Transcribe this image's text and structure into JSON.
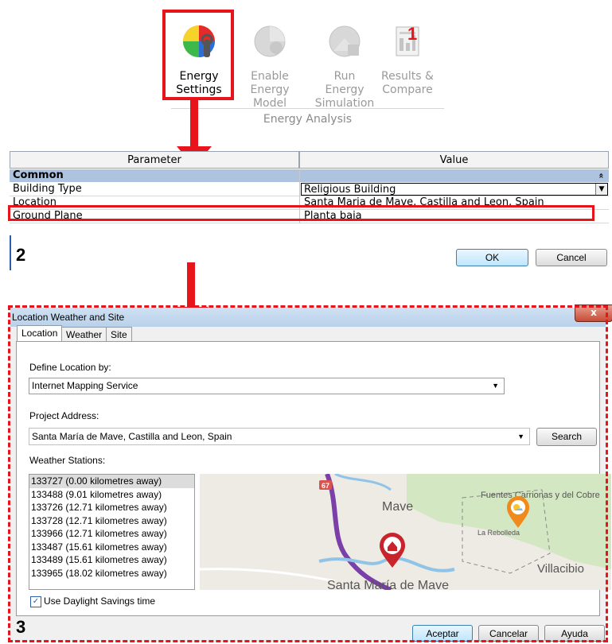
{
  "ribbon": {
    "buttons": [
      {
        "line1": "Energy",
        "line2": "Settings",
        "enabled": true
      },
      {
        "line1": "Enable",
        "line2": "Energy Model",
        "enabled": false
      },
      {
        "line1": "Run Energy",
        "line2": "Simulation",
        "enabled": false
      },
      {
        "line1": "Results &",
        "line2": "Compare",
        "enabled": false
      }
    ],
    "panel_label": "Energy Analysis"
  },
  "step_numbers": {
    "one": "1",
    "two": "2",
    "three": "3"
  },
  "param_table": {
    "header_parameter": "Parameter",
    "header_value": "Value",
    "group_label": "Common",
    "collapse_glyph": "»",
    "rows": [
      {
        "name": "Building Type",
        "value": "Religious Building"
      },
      {
        "name": "Location",
        "value": "Santa Maria de Mave, Castilla and Leon, Spain"
      },
      {
        "name": "Ground Plane",
        "value": "Planta baja"
      }
    ],
    "ok_label": "OK",
    "cancel_label": "Cancel"
  },
  "dialog": {
    "title": "Location Weather and Site",
    "close_glyph": "x",
    "tabs": [
      "Location",
      "Weather",
      "Site"
    ],
    "define_location_label": "Define Location by:",
    "define_location_value": "Internet Mapping Service",
    "project_address_label": "Project Address:",
    "project_address_value": "Santa María de Mave, Castilla and Leon, Spain",
    "search_label": "Search",
    "weather_stations_label": "Weather Stations:",
    "stations": [
      "133727 (0.00 kilometres away)",
      "133488 (9.01 kilometres away)",
      "133726 (12.71 kilometres away)",
      "133728 (12.71 kilometres away)",
      "133966 (12.71 kilometres away)",
      "133487 (15.61 kilometres away)",
      "133489 (15.61 kilometres away)",
      "133965 (18.02 kilometres away)"
    ],
    "map": {
      "road_number": "67",
      "place_mave": "Mave",
      "place_fuentes": "Fuentes Carrionas y del Cobre",
      "place_rebolleda": "La Rebolleda",
      "place_villacibio": "Villacibio",
      "place_santa_maria": "Santa María de Mave"
    },
    "daylight_label": "Use Daylight Savings time",
    "daylight_checked": true,
    "accept_label": "Aceptar",
    "cancel_label": "Cancelar",
    "help_label": "Ayuda"
  },
  "colors": {
    "highlight": "#e8141c",
    "group_bar": "#aec3df",
    "map_green": "#d4e7c3"
  }
}
